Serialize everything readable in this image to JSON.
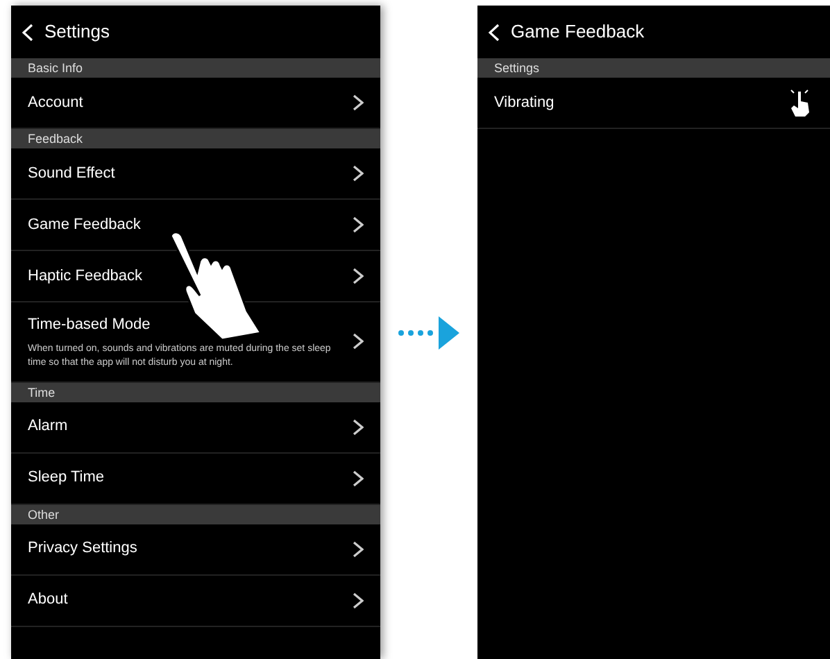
{
  "screens": [
    {
      "title": "Settings",
      "sections": [
        {
          "header": "Basic Info",
          "items": [
            {
              "label": "Account"
            }
          ]
        },
        {
          "header": "Feedback",
          "items": [
            {
              "label": "Sound Effect"
            },
            {
              "label": "Game Feedback"
            },
            {
              "label": "Haptic Feedback"
            },
            {
              "label": "Time-based Mode",
              "description": "When turned on, sounds and vibrations are muted during the set sleep time so that the app will not disturb you at night."
            }
          ]
        },
        {
          "header": "Time",
          "items": [
            {
              "label": "Alarm"
            },
            {
              "label": "Sleep Time"
            }
          ]
        },
        {
          "header": "Other",
          "items": [
            {
              "label": "Privacy Settings"
            },
            {
              "label": "About"
            }
          ]
        }
      ]
    },
    {
      "title": "Game Feedback",
      "sections": [
        {
          "header": "Settings",
          "items": [
            {
              "label": "Vibrating",
              "kind": "tap"
            }
          ]
        }
      ]
    }
  ]
}
